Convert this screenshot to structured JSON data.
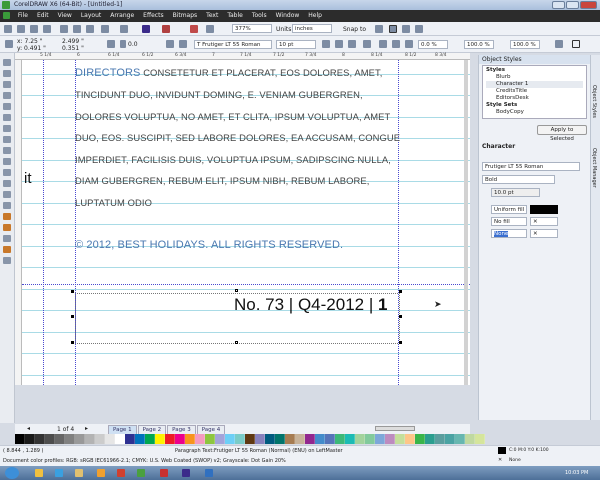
{
  "window": {
    "title": "CorelDRAW X6 (64-Bit) - [Untitled-1]"
  },
  "menu": [
    "File",
    "Edit",
    "View",
    "Layout",
    "Arrange",
    "Effects",
    "Bitmaps",
    "Text",
    "Table",
    "Tools",
    "Window",
    "Help"
  ],
  "toolbar": {
    "zoom": "377%",
    "units_label": "Units:",
    "units": "inches",
    "snap_label": "Snap to"
  },
  "property_bar": {
    "x": "x: 7.25 \"",
    "y": "y: 0.491 \"",
    "w": "2.499 \"",
    "h": "0.351 \"",
    "angle": "0.0",
    "font": "Frutiger LT 55 Roman",
    "size": "10 pt",
    "char_spacing": "0.0 %",
    "word_spacing": "100.0 %",
    "line_spacing": "100.0 %"
  },
  "ruler": [
    "5 1/4",
    "6",
    "6 1/4",
    "6 1/2",
    "6 3/4",
    "7",
    "7 1/4",
    "7 1/2",
    "7 3/4",
    "8",
    "8 1/4",
    "8 1/2",
    "8 3/4"
  ],
  "ruler_units": "inches",
  "document": {
    "lines": [
      {
        "lead": "DIRECTORS",
        "text": " CONSETETUR ET PLACERAT, EOS DOLORES, AMET,"
      },
      {
        "text": "TINCIDUNT DUO, INVIDUNT DOMING, E. VENIAM GUBERGREN,"
      },
      {
        "text": "DOLORES VOLUPTUA, NO AMET, ET CLITA, IPSUM VOLUPTUA, AMET"
      },
      {
        "text": "DUO, EOS. SUSCIPIT, SED LABORE DOLORES, EA ACCUSAM, CONGUE"
      },
      {
        "text": "IMPERDIET, FACILISIS DUIS, VOLUPTUA IPSUM, SADIPSCING NULLA,"
      },
      {
        "text": "DIAM GUBERGREN, REBUM ELIT, IPSUM NIBH, REBUM LABORE,"
      },
      {
        "text": "LUPTATUM ODIO"
      }
    ],
    "copyright": "© 2012, BEST HOLIDAYS. ALL RIGHTS RESERVED.",
    "left_fragment": "it",
    "footer": "No. 73 | Q4-2012 | ",
    "footer_bold": "1"
  },
  "docker": {
    "title": "Object Styles",
    "styles_header": "Styles",
    "styles": [
      "Blurb",
      "Character 1",
      "CreditsTitle",
      "EditorsDesk"
    ],
    "style_sets_header": "Style Sets",
    "style_sets": [
      "BodyCopy"
    ],
    "apply_button": "Apply to Selected",
    "character_header": "Character",
    "font": "Frutiger LT 55 Roman",
    "weight": "Bold",
    "size": "10.0 pt",
    "fill1": "Uniform fill",
    "fill2": "No fill",
    "outline": "None",
    "tabs": [
      "Object Styles",
      "Object Manager"
    ]
  },
  "pages": {
    "counter": "1 of 4",
    "tabs": [
      "Page 1",
      "Page 2",
      "Page 3",
      "Page 4"
    ]
  },
  "palette": [
    "#000000",
    "#1a1a1a",
    "#333333",
    "#4d4d4d",
    "#666666",
    "#808080",
    "#999999",
    "#b3b3b3",
    "#cccccc",
    "#e6e6e6",
    "#ffffff",
    "#2e3192",
    "#0072bc",
    "#00a651",
    "#fff200",
    "#ed1c24",
    "#ec008c",
    "#f7941d",
    "#f49ac1",
    "#8dc63f",
    "#a3a3d9",
    "#6dcff6",
    "#7accc8",
    "#603913",
    "#8781bd",
    "#005b7f",
    "#00746b",
    "#a67c52",
    "#c7b299",
    "#92278f",
    "#448ccb",
    "#5674b9",
    "#3cb878",
    "#1cbbb4",
    "#a2d39c",
    "#82ca9c",
    "#7da7d9",
    "#bd8cbf",
    "#c4df9b",
    "#fdc689",
    "#39b54a",
    "#2b9e8f",
    "#5a9e9e",
    "#4aa3a3",
    "#67b7b0",
    "#c0d9a0",
    "#d5e59c"
  ],
  "status": {
    "coords": "( 8.844 , 1.289 )",
    "info": "Paragraph Text:Frutiger LT 55 Roman (Normal) (ENU) on LeftMaster",
    "profiles": "Document color profiles: RGB: sRGB IEC61966-2.1; CMYK: U.S. Web Coated (SWOP) v2; Grayscale: Dot Gain 20%",
    "fill": "C:0 M:0 Y:0 K:100",
    "outline": "None"
  },
  "taskbar": {
    "time": "10:03 PM"
  }
}
